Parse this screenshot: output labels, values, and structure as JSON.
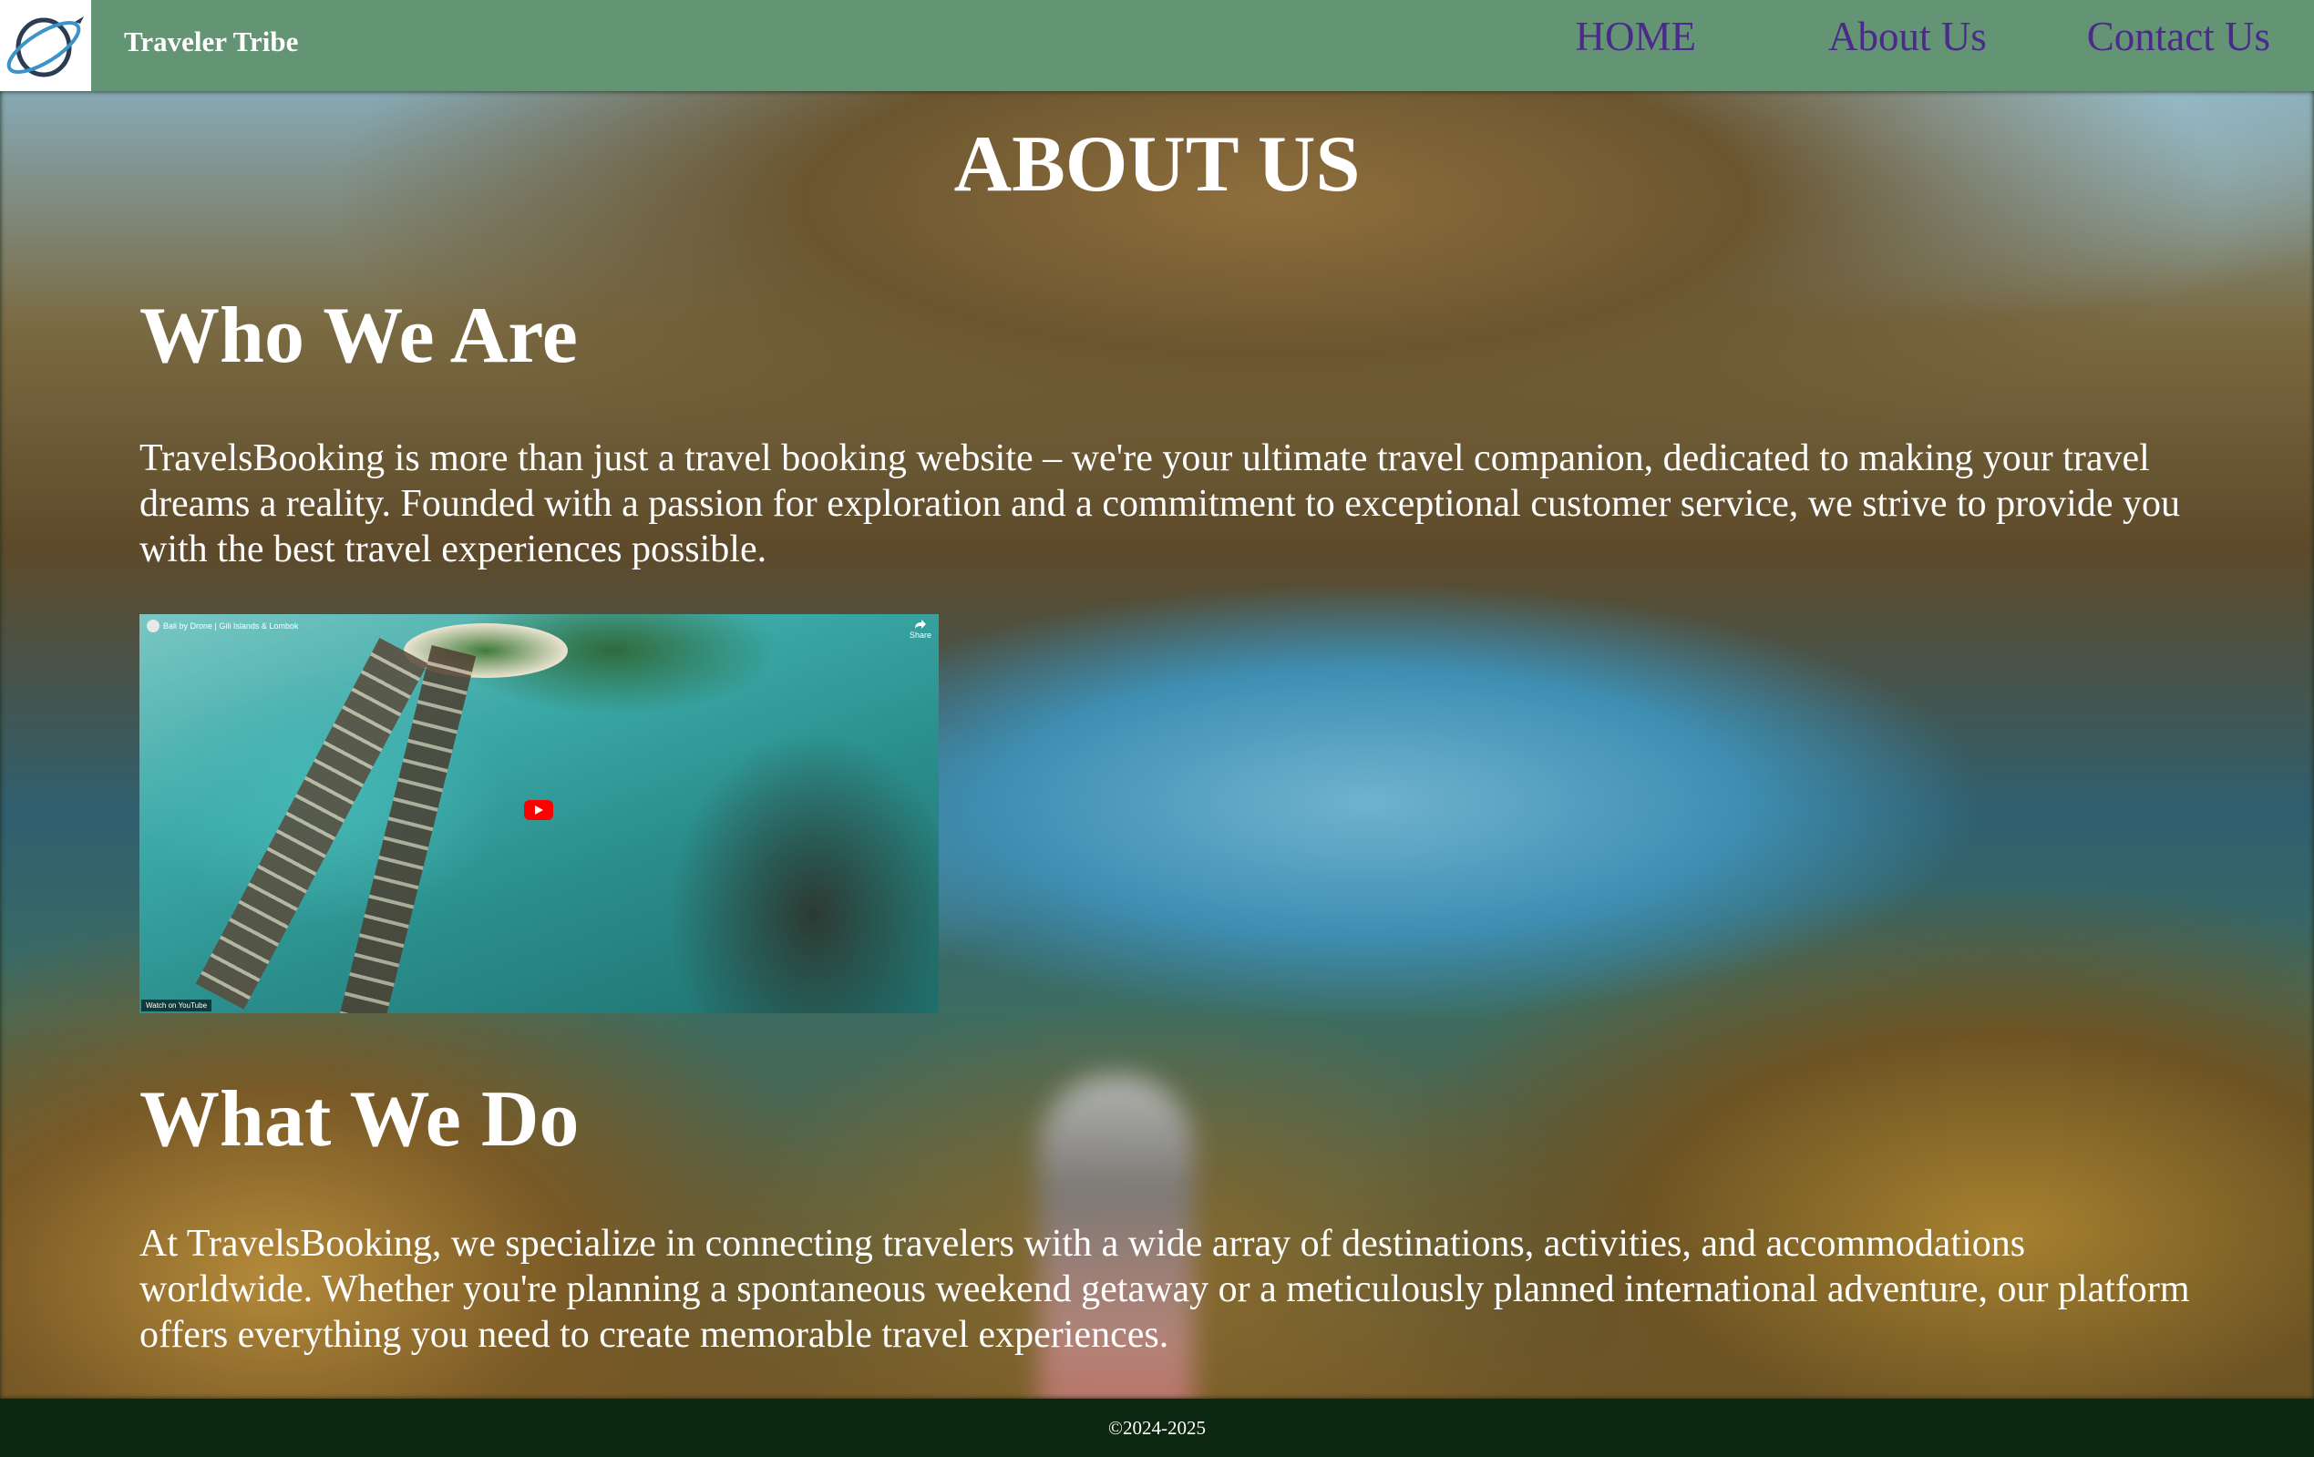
{
  "header": {
    "brand": "Traveler Tribe",
    "nav": [
      {
        "label": "HOME"
      },
      {
        "label": "About Us"
      },
      {
        "label": "Contact Us"
      }
    ]
  },
  "main": {
    "page_title": "ABOUT US",
    "sections": [
      {
        "heading": "Who We Are",
        "text": "TravelsBooking is more than just a travel booking website – we're your ultimate travel companion, dedicated to making your travel dreams a reality. Founded with a passion for exploration and a commitment to exceptional customer service, we strive to provide you with the best travel experiences possible."
      },
      {
        "heading": "What We Do",
        "text": "At TravelsBooking, we specialize in connecting travelers with a wide array of destinations, activities, and accommodations worldwide. Whether you're planning a spontaneous weekend getaway or a meticulously planned international adventure, our platform offers everything you need to create memorable travel experiences."
      }
    ],
    "video": {
      "title": "Bali by Drone | Gili Islands & Lombok",
      "share_label": "Share",
      "watch_label": "Watch on YouTube"
    }
  },
  "footer": {
    "copyright": "©2024-2025"
  },
  "colors": {
    "header_bg": "#639474",
    "nav_link": "#4b2a8c",
    "footer_bg": "#0c2810",
    "text": "#ffffff"
  }
}
